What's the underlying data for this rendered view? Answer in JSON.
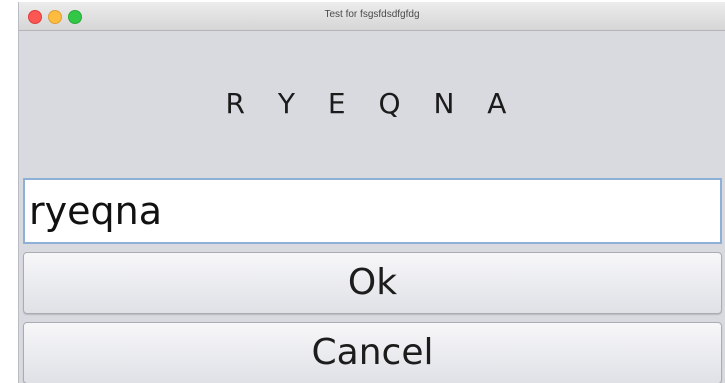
{
  "window": {
    "title": "Test for fsgsfdsdfgfdg"
  },
  "prompt": {
    "text": "R Y E Q N A"
  },
  "answer_field": {
    "value": "ryeqna"
  },
  "buttons": {
    "ok_label": "Ok",
    "cancel_label": "Cancel"
  }
}
